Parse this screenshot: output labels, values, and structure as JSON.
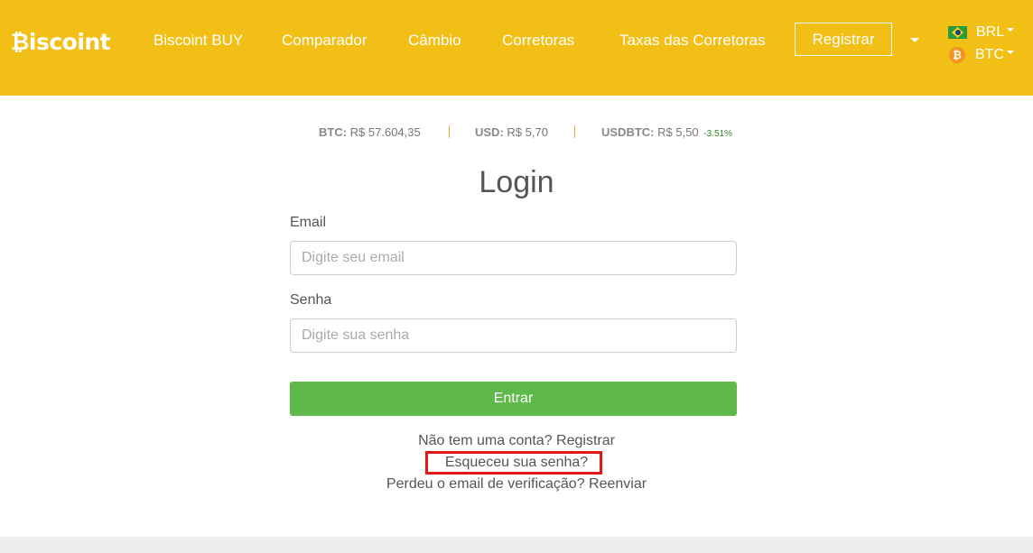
{
  "header": {
    "logo": "₿iscoint",
    "nav": [
      "Biscoint BUY",
      "Comparador",
      "Câmbio",
      "Corretoras",
      "Taxas das Corretoras"
    ],
    "register_label": "Registrar",
    "currencies": [
      {
        "code": "BRL",
        "icon": "brazil-flag-icon"
      },
      {
        "code": "BTC",
        "icon": "bitcoin-icon"
      }
    ],
    "accent_color": "#f2bf16"
  },
  "ticker": [
    {
      "label": "BTC:",
      "value": "R$ 57.604,35"
    },
    {
      "label": "USD:",
      "value": "R$ 5,70"
    },
    {
      "label": "USDBTC:",
      "value": "R$ 5,50",
      "change": "-3.51%"
    }
  ],
  "login": {
    "title": "Login",
    "email_label": "Email",
    "email_placeholder": "Digite seu email",
    "password_label": "Senha",
    "password_placeholder": "Digite sua senha",
    "submit_label": "Entrar",
    "submit_color": "#5fb84a"
  },
  "links": {
    "register": "Não tem uma conta? Registrar",
    "forgot": "Esqueceu sua senha?",
    "resend": "Perdeu o email de verificação? Reenviar"
  }
}
